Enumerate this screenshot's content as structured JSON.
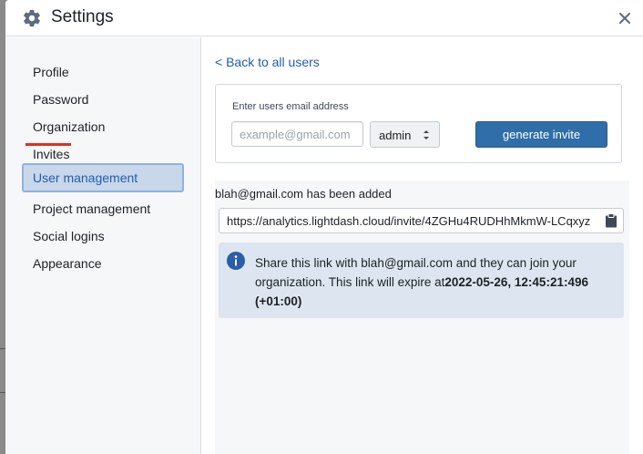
{
  "header": {
    "title": "Settings",
    "icon": "gear-icon",
    "close_icon": "close-icon"
  },
  "sidebar": {
    "items": [
      {
        "label": "Profile"
      },
      {
        "label": "Password"
      },
      {
        "label": "Organization"
      },
      {
        "label": "Invites"
      },
      {
        "label": "User management",
        "active": true
      },
      {
        "label": "Project management"
      },
      {
        "label": "Social logins"
      },
      {
        "label": "Appearance"
      }
    ]
  },
  "main": {
    "back_link": "< Back to all users",
    "invite_form": {
      "email_label": "Enter users email address",
      "email_placeholder": "example@gmail.com",
      "email_value": "",
      "role_value": "admin",
      "generate_label": "generate invite"
    },
    "result": {
      "added_text": "blah@gmail.com has been added",
      "invite_link": "https://analytics.lightdash.cloud/invite/4ZGHu4RUDHhMkmW-LCqxyz",
      "callout_prefix": "Share this link with blah@gmail.com and they can join your organization. This link will expire at",
      "callout_expiry": "2022-05-26, 12:45:21:496 (+01:00)"
    }
  },
  "colors": {
    "accent": "#2f6ea8",
    "active_nav_bg": "#c9d7ea",
    "callout_bg": "#dde6f0",
    "annotation_red": "#e0301e"
  }
}
